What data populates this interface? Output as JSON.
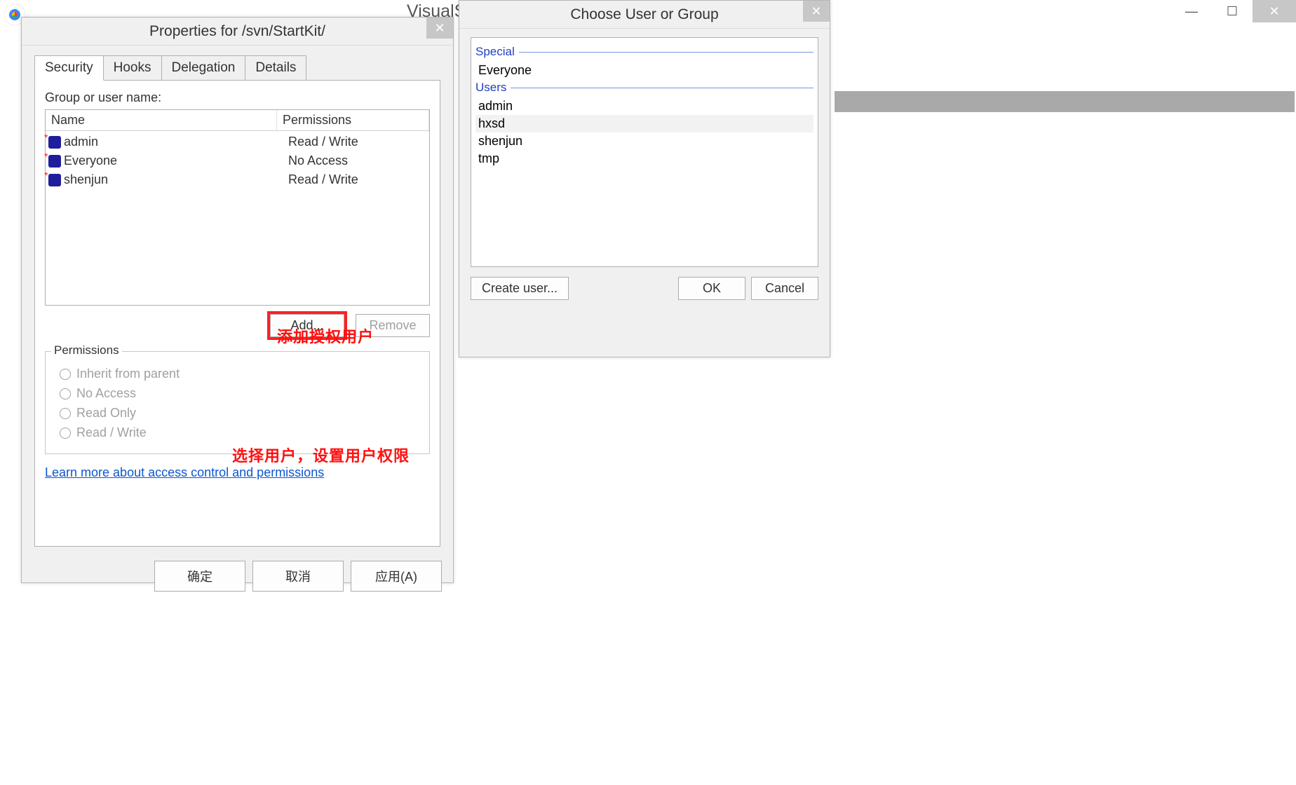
{
  "backdrop_title": "VisualSVN Server",
  "props_dialog": {
    "title": "Properties for /svn/StartKit/",
    "tabs": {
      "security": "Security",
      "hooks": "Hooks",
      "delegation": "Delegation",
      "details": "Details"
    },
    "group_label": "Group or user name:",
    "col_name": "Name",
    "col_perm": "Permissions",
    "rows": [
      {
        "name": "admin",
        "perm": "Read / Write"
      },
      {
        "name": "Everyone",
        "perm": "No Access"
      },
      {
        "name": "shenjun",
        "perm": "Read / Write"
      }
    ],
    "add": "Add...",
    "remove": "Remove",
    "perm_box_title": "Permissions",
    "perm_options": {
      "inherit": "Inherit from parent",
      "noaccess": "No Access",
      "readonly": "Read Only",
      "readwrite": "Read / Write"
    },
    "learn_more": "Learn more about access control and permissions",
    "ok": "确定",
    "cancel": "取消",
    "apply": "应用(A)"
  },
  "choose_dialog": {
    "title": "Choose User or Group",
    "special": "Special",
    "special_items": {
      "everyone": "Everyone"
    },
    "users": "Users",
    "user_items": {
      "admin": "admin",
      "hxsd": "hxsd",
      "shenjun": "shenjun",
      "tmp": "tmp"
    },
    "create": "Create user...",
    "ok": "OK",
    "cancel": "Cancel",
    "selected": "hxsd"
  },
  "annotations": {
    "add_user": "添加授权用户",
    "set_perm": "选择用户，设置用户权限"
  },
  "win_controls": {
    "min": "—",
    "max": "☐",
    "close": "✕"
  }
}
